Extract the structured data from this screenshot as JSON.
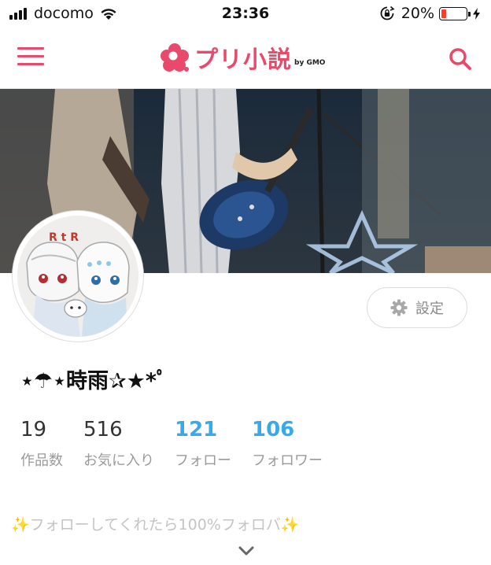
{
  "status_bar": {
    "carrier": "docomo",
    "time": "23:36",
    "battery_percent": "20%",
    "battery_level": 0.2,
    "battery_color": "#ff3b30"
  },
  "nav": {
    "logo_text": "プリ小説",
    "logo_by": "by GMO",
    "brand_color": "#e94a6b",
    "menu_icon": "hamburger-icon",
    "search_icon": "search-icon"
  },
  "profile": {
    "avatar_text": "R t R",
    "name": "⋆☂︎⋆時雨✰★*ﾟ",
    "settings_label": "設定",
    "settings_icon": "gear-icon",
    "stats": [
      {
        "value": "19",
        "label": "作品数"
      },
      {
        "value": "516",
        "label": "お気に入り"
      },
      {
        "value": "121",
        "label": "フォロー"
      },
      {
        "value": "106",
        "label": "フォロワー"
      }
    ],
    "accent_color": "#3aa9e8",
    "bio": "✨フォローしてくれたら100%フォロバ✨",
    "expand_icon": "chevron-down-icon"
  }
}
